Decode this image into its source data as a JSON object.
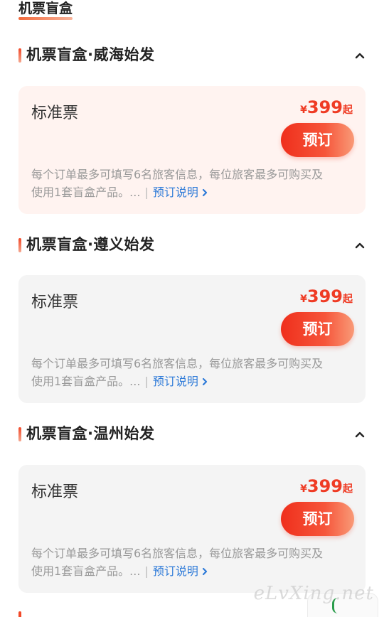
{
  "header": {
    "tab_label": "机票盲盒"
  },
  "sections": [
    {
      "title": "机票盲盒·威海始发",
      "card": {
        "ticket_name": "标准票",
        "price_currency": "¥",
        "price_amount": "399",
        "price_suffix": "起",
        "button_label": "预订",
        "desc_line1": "每个订单最多可填写6名旅客信息，每位旅客最多可购买及",
        "desc_line2": "使用1套盲盒产品。...",
        "separator": "|",
        "link_label": "预订说明"
      }
    },
    {
      "title": "机票盲盒·遵义始发",
      "card": {
        "ticket_name": "标准票",
        "price_currency": "¥",
        "price_amount": "399",
        "price_suffix": "起",
        "button_label": "预订",
        "desc_line1": "每个订单最多可填写6名旅客信息，每位旅客最多可购买及",
        "desc_line2": "使用1套盲盒产品。...",
        "separator": "|",
        "link_label": "预订说明"
      }
    },
    {
      "title": "机票盲盒·温州始发",
      "card": {
        "ticket_name": "标准票",
        "price_currency": "¥",
        "price_amount": "399",
        "price_suffix": "起",
        "button_label": "预订",
        "desc_line1": "每个订单最多可填写6名旅客信息，每位旅客最多可购买及",
        "desc_line2": "使用1套盲盒产品。...",
        "separator": "|",
        "link_label": "预订说明"
      }
    }
  ],
  "watermark": "eLvXing.net",
  "colors": {
    "accent": "#ef3b24",
    "link": "#2d7ad8",
    "highlight_card_bg": "#fff3f0",
    "card_bg": "#f4f4f4"
  },
  "icons": {
    "collapse": "chevron-up-icon",
    "link_arrow": "chevron-right-icon"
  }
}
